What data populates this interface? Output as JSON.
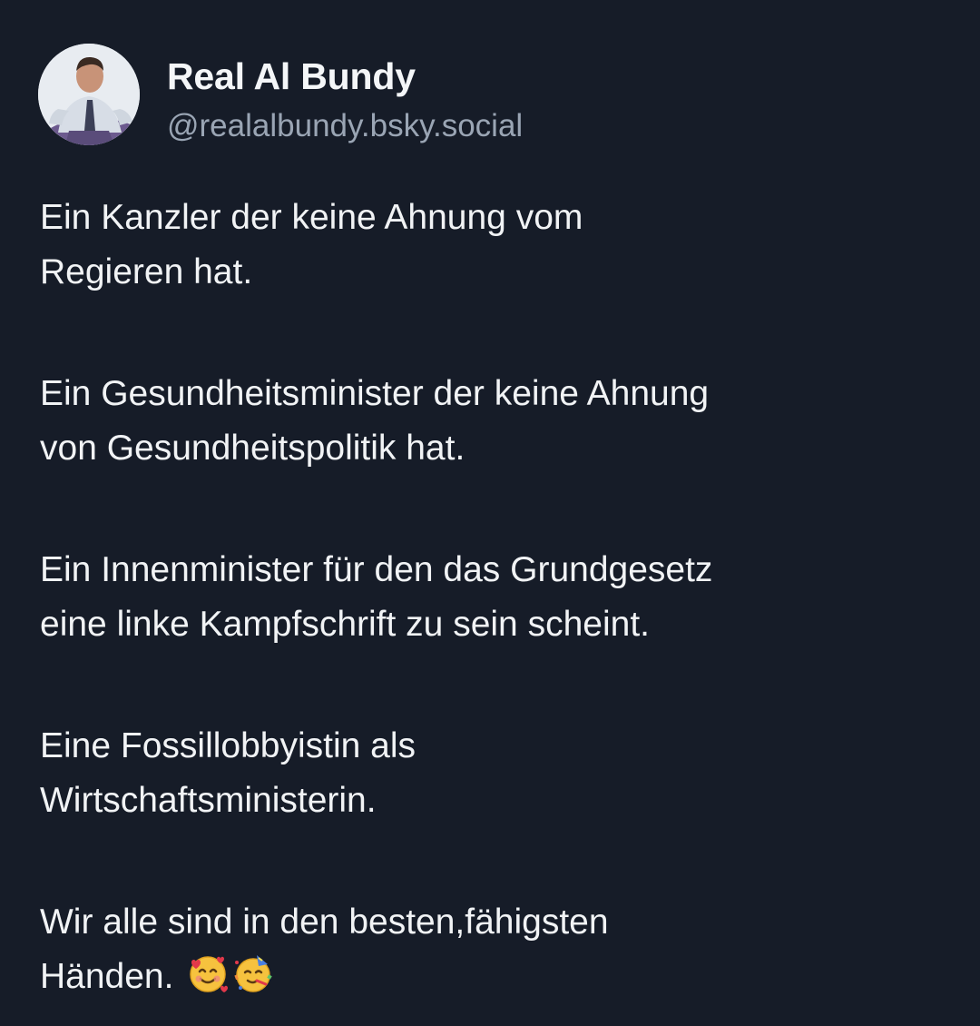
{
  "post": {
    "author": {
      "display_name": "Real Al Bundy",
      "handle": "@realalbundy.bsky.social",
      "avatar_icon": "avatar-portrait"
    },
    "paragraphs": [
      "Ein Kanzler der keine Ahnung vom\nRegieren hat.",
      "Ein Gesundheitsminister der keine Ahnung\nvon Gesundheitspolitik hat.",
      "Ein Innenminister für den das Grundgesetz\neine linke Kampfschrift zu sein scheint.",
      "Eine Fossillobbyistin als\nWirtschaftsministerin.",
      "Wir alle sind in den besten,fähigsten\nHänden."
    ],
    "emojis": [
      "smiling-face-with-hearts-icon",
      "partying-face-icon"
    ]
  },
  "colors": {
    "background": "#161c28",
    "text": "#f1f3f5",
    "handle": "#9aa5b4"
  }
}
